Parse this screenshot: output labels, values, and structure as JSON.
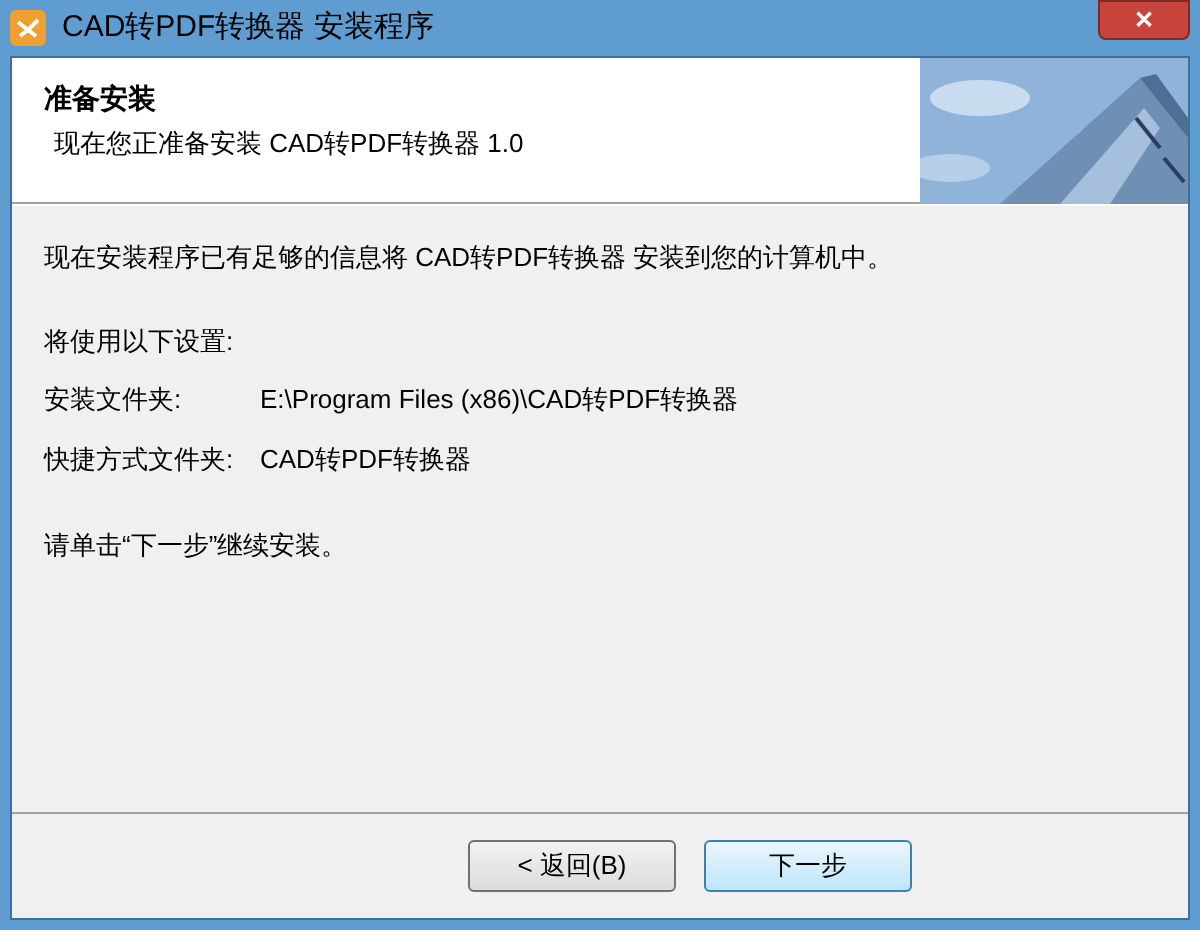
{
  "window": {
    "title": "CAD转PDF转换器 安装程序",
    "close": "✕"
  },
  "header": {
    "title": "准备安装",
    "subtitle": "现在您正准备安装 CAD转PDF转换器 1.0"
  },
  "body": {
    "intro": "现在安装程序已有足够的信息将 CAD转PDF转换器 安装到您的计算机中。",
    "settings_heading": "将使用以下设置:",
    "settings": [
      {
        "label": "安装文件夹:",
        "value": "E:\\Program Files (x86)\\CAD转PDF转换器"
      },
      {
        "label": "快捷方式文件夹:",
        "value": "CAD转PDF转换器"
      }
    ],
    "footer": "请单击“下一步”继续安装。"
  },
  "buttons": [
    {
      "label": "< 返回(B)",
      "selected": false
    },
    {
      "label": "下一步",
      "selected": true
    }
  ]
}
